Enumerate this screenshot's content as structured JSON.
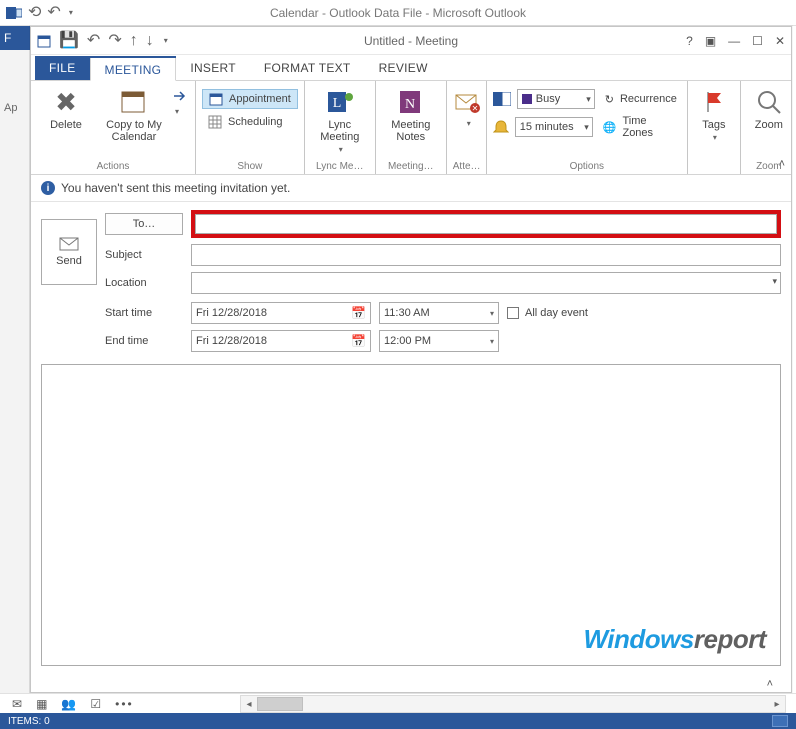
{
  "parent": {
    "title": "Calendar - Outlook Data File - Microsoft Outlook",
    "file_tab": "F",
    "app_label": "Ap",
    "status_items": "ITEMS: 0"
  },
  "window": {
    "title": "Untitled - Meeting"
  },
  "tabs": {
    "file": "FILE",
    "meeting": "MEETING",
    "insert": "INSERT",
    "format_text": "FORMAT TEXT",
    "review": "REVIEW"
  },
  "ribbon": {
    "actions": {
      "delete": "Delete",
      "copy": "Copy to My Calendar",
      "group": "Actions"
    },
    "show": {
      "appointment": "Appointment",
      "scheduling": "Scheduling",
      "group": "Show"
    },
    "lync": {
      "label": "Lync Meeting",
      "group": "Lync Me…"
    },
    "notes": {
      "label": "Meeting Notes",
      "group": "Meeting…"
    },
    "attendees": {
      "group": "Atte…"
    },
    "options": {
      "busy": "Busy",
      "reminder": "15 minutes",
      "recurrence": "Recurrence",
      "timezones": "Time Zones",
      "group": "Options"
    },
    "tags": {
      "label": "Tags",
      "group": ""
    },
    "zoom": {
      "label": "Zoom",
      "group": "Zoom"
    }
  },
  "info": {
    "text": "You haven't sent this meeting invitation yet."
  },
  "form": {
    "send": "Send",
    "to_btn": "To…",
    "to_value": "",
    "subject_label": "Subject",
    "subject_value": "",
    "location_label": "Location",
    "location_value": "",
    "start_label": "Start time",
    "end_label": "End time",
    "start_date": "Fri 12/28/2018",
    "start_time": "11:30 AM",
    "end_date": "Fri 12/28/2018",
    "end_time": "12:00 PM",
    "allday": "All day event"
  },
  "watermark": {
    "part1": "Windows",
    "part2": "report"
  }
}
